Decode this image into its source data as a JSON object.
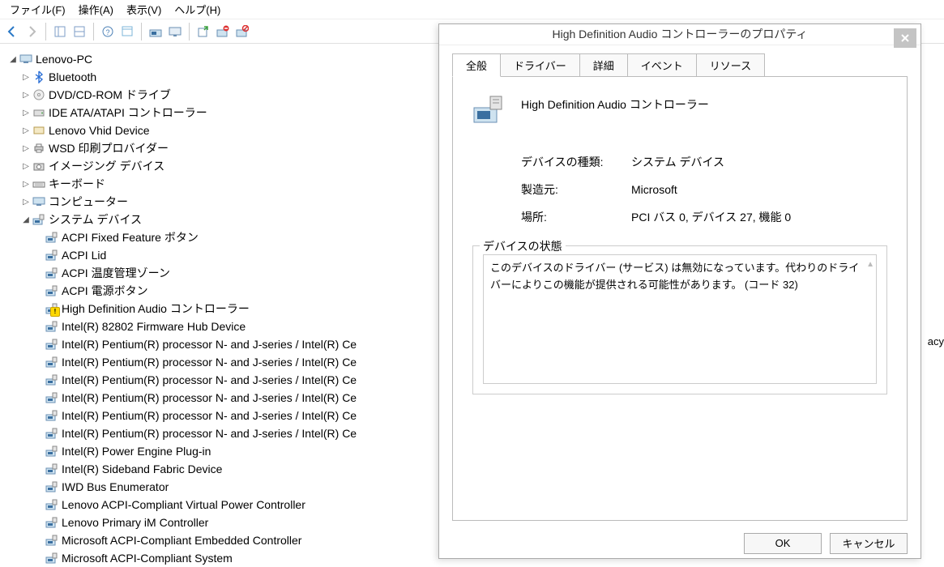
{
  "menubar": {
    "file": "ファイル(F)",
    "action": "操作(A)",
    "view": "表示(V)",
    "help": "ヘルプ(H)"
  },
  "tree": {
    "root": "Lenovo-PC",
    "cat_bluetooth": "Bluetooth",
    "cat_dvd": "DVD/CD-ROM ドライブ",
    "cat_ide": "IDE ATA/ATAPI コントローラー",
    "cat_lenovovhid": "Lenovo Vhid Device",
    "cat_wsd": "WSD 印刷プロバイダー",
    "cat_imaging": "イメージング デバイス",
    "cat_keyboard": "キーボード",
    "cat_computer": "コンピューター",
    "cat_system": "システム デバイス",
    "dev_acpi_fixed": "ACPI Fixed Feature ボタン",
    "dev_acpi_lid": "ACPI Lid",
    "dev_acpi_thermal": "ACPI 温度管理ゾーン",
    "dev_acpi_power": "ACPI 電源ボタン",
    "dev_hdaudio": "High Definition Audio コントローラー",
    "dev_82802": "Intel(R) 82802 Firmware Hub Device",
    "dev_pentium1": "Intel(R) Pentium(R) processor N- and J-series / Intel(R) Ce",
    "dev_pentium2": "Intel(R) Pentium(R) processor N- and J-series / Intel(R) Ce",
    "dev_pentium3": "Intel(R) Pentium(R) processor N- and J-series / Intel(R) Ce",
    "dev_pentium4": "Intel(R) Pentium(R) processor N- and J-series / Intel(R) Ce",
    "dev_pentium5": "Intel(R) Pentium(R) processor N- and J-series / Intel(R) Ce",
    "dev_pentium6": "Intel(R) Pentium(R) processor N- and J-series / Intel(R) Ce",
    "dev_powerengine": "Intel(R) Power Engine Plug-in",
    "dev_sideband": "Intel(R) Sideband Fabric Device",
    "dev_iwd": "IWD Bus Enumerator",
    "dev_lenovo_virtual": "Lenovo ACPI-Compliant Virtual Power Controller",
    "dev_lenovo_im": "Lenovo Primary iM Controller",
    "dev_ms_embedded": "Microsoft ACPI-Compliant Embedded Controller",
    "dev_ms_system": "Microsoft ACPI-Compliant System"
  },
  "dialog": {
    "title": "High Definition Audio コントローラーのプロパティ",
    "tab_general": "全般",
    "tab_driver": "ドライバー",
    "tab_details": "詳細",
    "tab_events": "イベント",
    "tab_resources": "リソース",
    "device_name": "High Definition Audio コントローラー",
    "label_type": "デバイスの種類:",
    "val_type": "システム デバイス",
    "label_mfr": "製造元:",
    "val_mfr": "Microsoft",
    "label_loc": "場所:",
    "val_loc": "PCI バス 0, デバイス 27, 機能 0",
    "fieldset_status": "デバイスの状態",
    "status_text": "このデバイスのドライバー (サービス) は無効になっています。代わりのドライバーによりこの機能が提供される可能性があります。 (コード 32)",
    "btn_ok": "OK",
    "btn_cancel": "キャンセル"
  },
  "side_text": "acy"
}
